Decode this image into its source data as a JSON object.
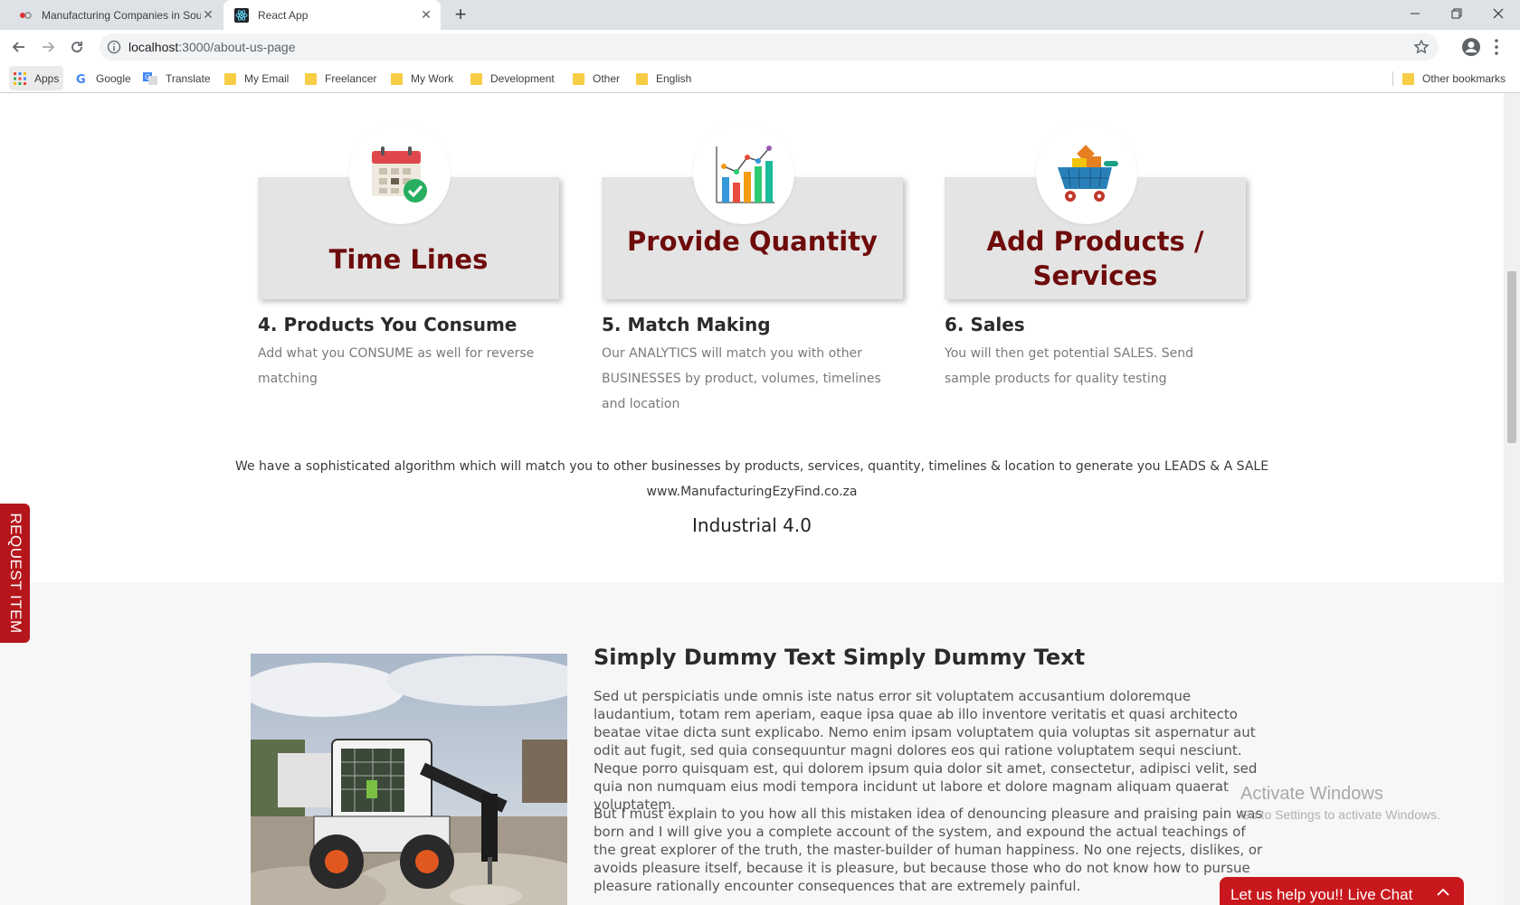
{
  "browser": {
    "tabs": [
      {
        "title": "Manufacturing Companies in Sou",
        "active": false
      },
      {
        "title": "React App",
        "active": true
      }
    ],
    "url_host": "localhost",
    "url_rest": ":3000/about-us-page",
    "bookmarks": {
      "apps": "Apps",
      "google": "Google",
      "translate": "Translate",
      "folders": [
        "My Email",
        "Freelancer",
        "My Work",
        "Development",
        "Other",
        "English"
      ],
      "other": "Other bookmarks"
    }
  },
  "features": [
    {
      "card_title": "Time Lines",
      "heading": "4. Products You Consume",
      "text": "Add what you CONSUME as well for reverse matching",
      "icon": "calendar-check-icon"
    },
    {
      "card_title": "Provide Quantity",
      "heading": "5. Match Making",
      "text": "Our ANALYTICS will match you with other BUSINESSES by product, volumes, timelines and location",
      "icon": "bar-chart-icon"
    },
    {
      "card_title": "Add Products / Services",
      "heading": "6. Sales",
      "text": "You will then get potential SALES. Send sample products for quality testing",
      "icon": "shopping-cart-icon"
    }
  ],
  "algorithm_text": "We have a sophisticated algorithm which will match you to other businesses by products, services, quantity, timelines & location to generate you LEADS & A SALE",
  "site_url": "www.ManufacturingEzyFind.co.za",
  "industrial": "Industrial 4.0",
  "section": {
    "title": "Simply Dummy Text Simply Dummy Text",
    "para1": "Sed ut perspiciatis unde omnis iste natus error sit voluptatem accusantium doloremque laudantium, totam rem aperiam, eaque ipsa quae ab illo inventore veritatis et quasi architecto beatae vitae dicta sunt explicabo. Nemo enim ipsam voluptatem quia voluptas sit aspernatur aut odit aut fugit, sed quia consequuntur magni dolores eos qui ratione voluptatem sequi nesciunt. Neque porro quisquam est, qui dolorem ipsum quia dolor sit amet, consectetur, adipisci velit, sed quia non numquam eius modi tempora incidunt ut labore et dolore magnam aliquam quaerat voluptatem.",
    "para2": "But I must explain to you how all this mistaken idea of denouncing pleasure and praising pain was born and I will give you a complete account of the system, and expound the actual teachings of the great explorer of the truth, the master-builder of human happiness. No one rejects, dislikes, or avoids pleasure itself, because it is pleasure, but because those who do not know how to pursue pleasure rationally encounter consequences that are extremely painful."
  },
  "request_item": "REQUEST ITEM",
  "activate": {
    "line1": "Activate Windows",
    "line2": "Go to Settings to activate Windows."
  },
  "live_chat": "Let us help you!! Live Chat",
  "colors": {
    "brand_red": "#c8181d",
    "title_maroon": "#6e0b0b"
  }
}
